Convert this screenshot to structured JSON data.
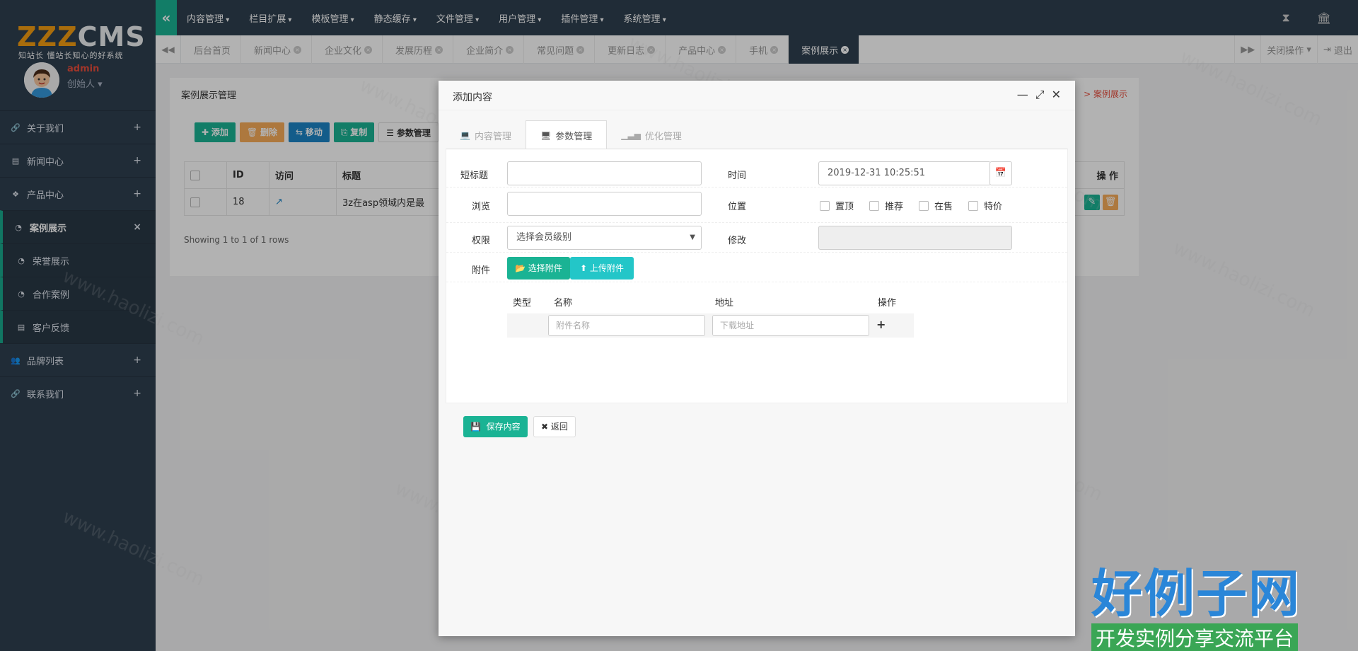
{
  "sidebar": {
    "logo_a": "ZZZ",
    "logo_b": "CMS",
    "slogan": "知站长 懂站长知心的好系统",
    "user_name": "admin",
    "user_role": "创始人",
    "items": [
      {
        "label": "关于我们",
        "icon": "link-icon",
        "expand": "+"
      },
      {
        "label": "新闻中心",
        "icon": "newspaper-icon",
        "expand": "+"
      },
      {
        "label": "产品中心",
        "icon": "cubes-icon",
        "expand": "+"
      },
      {
        "label": "案例展示",
        "icon": "pie-icon",
        "expand": "×"
      },
      {
        "label": "荣誉展示",
        "icon": "pie-icon"
      },
      {
        "label": "合作案例",
        "icon": "pie-icon"
      },
      {
        "label": "客户反馈",
        "icon": "newspaper-icon"
      },
      {
        "label": "品牌列表",
        "icon": "users-icon",
        "expand": "+"
      },
      {
        "label": "联系我们",
        "icon": "link-icon",
        "expand": "+"
      }
    ]
  },
  "topnav": [
    "内容管理",
    "栏目扩展",
    "模板管理",
    "静态缓存",
    "文件管理",
    "用户管理",
    "插件管理",
    "系统管理"
  ],
  "tabs": [
    "后台首页",
    "新闻中心",
    "企业文化",
    "发展历程",
    "企业简介",
    "常见问题",
    "更新日志",
    "产品中心",
    "手机",
    "案例展示"
  ],
  "tabs_right": {
    "close_ops": "关闭操作",
    "logout": "退出"
  },
  "background_page": {
    "title": "案例展示管理",
    "breadcrumb_tail": "> 案例展示",
    "buttons": [
      "添加",
      "删除",
      "移动",
      "复制",
      "参数管理"
    ],
    "table_headers": [
      "",
      "ID",
      "访问",
      "标题"
    ],
    "row": {
      "id": "18",
      "title": "3z在asp领域内是最"
    },
    "ops_header": "操 作",
    "info": "Showing 1 to 1 of 1 rows"
  },
  "modal": {
    "title": "添加内容",
    "tabs": [
      "内容管理",
      "参数管理",
      "优化管理"
    ],
    "fields": {
      "short_title_label": "短标题",
      "time_label": "时间",
      "time_value": "2019-12-31 10:25:51",
      "views_label": "浏览",
      "position_label": "位置",
      "position_options": [
        "置顶",
        "推荐",
        "在售",
        "特价"
      ],
      "permission_label": "权限",
      "permission_value": "选择会员级别",
      "modify_label": "修改",
      "attachment_label": "附件",
      "select_attachment": "选择附件",
      "upload_attachment": "上传附件"
    },
    "attachment_table": {
      "headers": [
        "类型",
        "名称",
        "地址",
        "操作"
      ],
      "name_placeholder": "附件名称",
      "url_placeholder": "下载地址",
      "add": "+"
    },
    "save_label": "保存内容",
    "back_label": "返回"
  },
  "watermark": {
    "text": "www.haolizi.com",
    "brand": "好例子网",
    "brand_sub": "开发实例分享交流平台"
  },
  "colors": {
    "sidebar": "#2f4050",
    "accent": "#1ab394",
    "info": "#23c6c8"
  }
}
